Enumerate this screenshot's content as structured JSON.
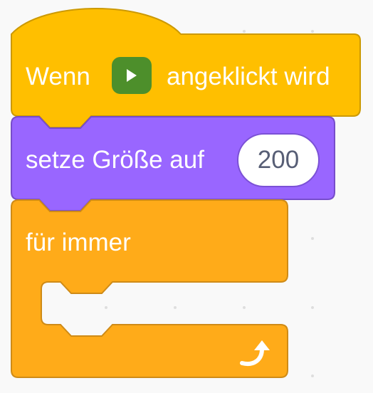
{
  "workspace": {
    "background_color": "#f9f9f9",
    "dot_color": "#dedede"
  },
  "blocks": {
    "when_flag_clicked": {
      "text_before": "Wenn",
      "text_after": "angeklickt wird",
      "icon": "green-flag-icon",
      "color": "#ffbf00"
    },
    "set_size": {
      "text": "setze Größe auf",
      "value": "200",
      "color": "#9966ff"
    },
    "forever": {
      "text": "für immer",
      "icon": "loop-arrow-icon",
      "color": "#ffab19"
    }
  }
}
